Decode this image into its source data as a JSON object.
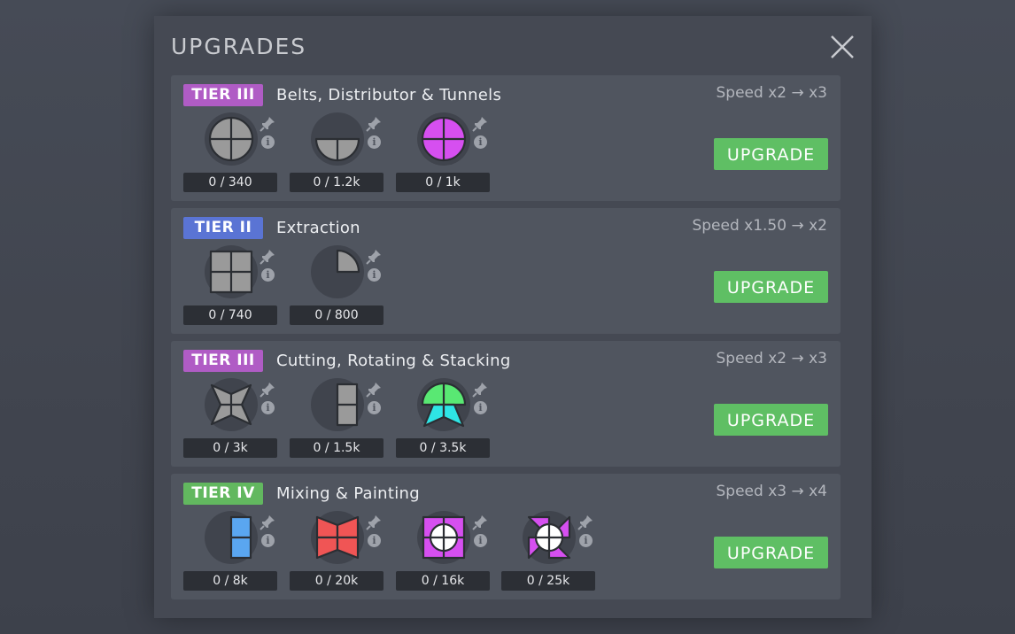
{
  "title": "UPGRADES",
  "close_icon": "close-icon",
  "upgrade_label": "UPGRADE",
  "colors": {
    "tier_iii": "#b05cc5",
    "tier_ii": "#5a74d4",
    "tier_iv": "#62b85f",
    "button": "#5fbf64"
  },
  "upgrades": [
    {
      "tier": "TIER III",
      "tier_color": "#b05cc5",
      "name": "Belts, Distributor & Tunnels",
      "speed": "Speed x2 → x3",
      "requirements": [
        {
          "shape": "circle-gray-quarters",
          "progress": "0 / 340"
        },
        {
          "shape": "half-circle-gray",
          "progress": "0 / 1.2k"
        },
        {
          "shape": "circle-purple-quarters",
          "progress": "0 / 1k"
        }
      ]
    },
    {
      "tier": "TIER II",
      "tier_color": "#5a74d4",
      "name": "Extraction",
      "speed": "Speed x1.50 → x2",
      "requirements": [
        {
          "shape": "square-gray-quarters",
          "progress": "0 / 740"
        },
        {
          "shape": "quarter-circle-gray",
          "progress": "0 / 800"
        }
      ]
    },
    {
      "tier": "TIER III",
      "tier_color": "#b05cc5",
      "name": "Cutting, Rotating & Stacking",
      "speed": "Speed x2 → x3",
      "requirements": [
        {
          "shape": "star-gray",
          "progress": "0 / 3k"
        },
        {
          "shape": "half-square-gray",
          "progress": "0 / 1.5k"
        },
        {
          "shape": "circle-green-star-cyan",
          "progress": "0 / 3.5k"
        }
      ]
    },
    {
      "tier": "TIER IV",
      "tier_color": "#62b85f",
      "name": "Mixing & Painting",
      "speed": "Speed x3 → x4",
      "requirements": [
        {
          "shape": "half-square-blue",
          "progress": "0 / 8k"
        },
        {
          "shape": "windmill-red",
          "progress": "0 / 20k"
        },
        {
          "shape": "square-purple-circle-white",
          "progress": "0 / 16k"
        },
        {
          "shape": "windmill-purple-circle-white",
          "progress": "0 / 25k"
        }
      ]
    }
  ]
}
